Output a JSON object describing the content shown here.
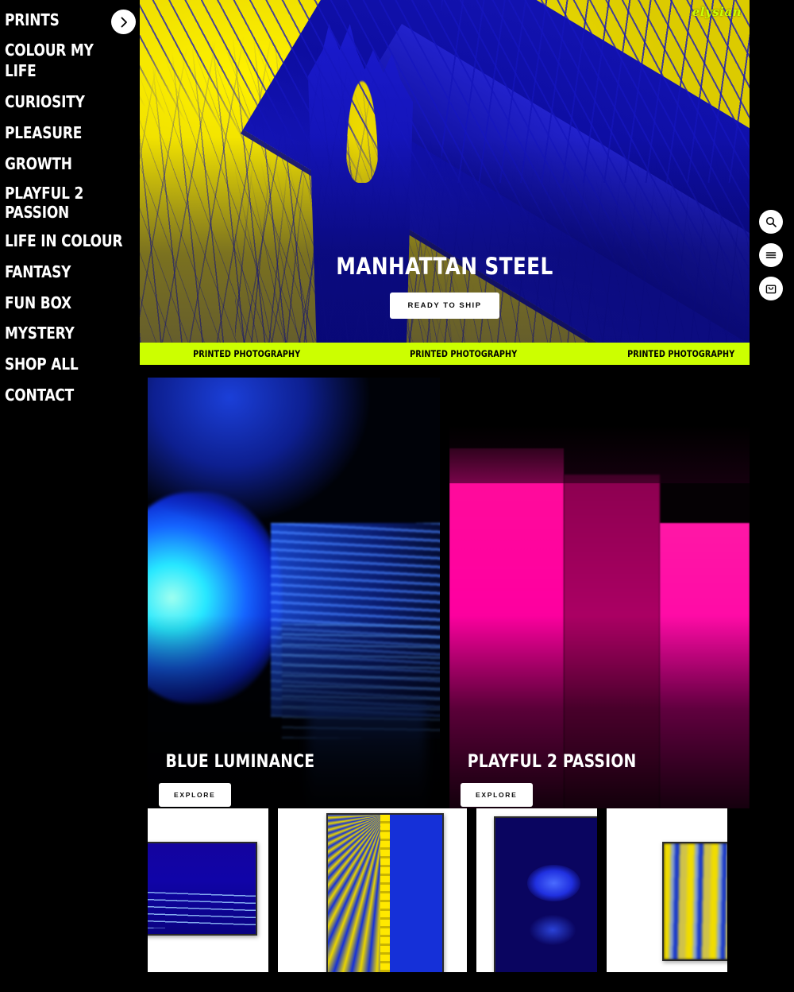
{
  "brand": {
    "logo_text": "elysian"
  },
  "sidebar": {
    "items": [
      {
        "label": "PRINTS",
        "name": "prints"
      },
      {
        "label": "COLOUR MY LIFE",
        "name": "colour-my-life"
      },
      {
        "label": "CURIOSITY",
        "name": "curiosity"
      },
      {
        "label": "PLEASURE",
        "name": "pleasure"
      },
      {
        "label": "GROWTH",
        "name": "growth"
      },
      {
        "label": "PLAYFUL 2\nPASSION",
        "name": "playful-2-passion"
      },
      {
        "label": "LIFE IN COLOUR",
        "name": "life-in-colour"
      },
      {
        "label": "FANTASY",
        "name": "fantasy"
      },
      {
        "label": "FUN BOX",
        "name": "fun-box"
      },
      {
        "label": "MYSTERY",
        "name": "mystery"
      },
      {
        "label": "SHOP ALL",
        "name": "shop-all"
      },
      {
        "label": "CONTACT",
        "name": "contact"
      }
    ],
    "expand_icon": "chevron-right-icon"
  },
  "hero": {
    "title": "MANHATTAN STEEL",
    "cta_label": "READY TO SHIP",
    "image_alt": "manhattan-bridge-duotone",
    "colors": {
      "sky": "#ecdc00",
      "structure": "#1414b4"
    }
  },
  "marquee": {
    "items": [
      "PRINTED PHOTOGRAPHY",
      "PRINTED PHOTOGRAPHY",
      "PRINTED PHOTOGRAPHY"
    ],
    "background": "#ccff00",
    "text_color": "#000000"
  },
  "collections": [
    {
      "title": "BLUE LUMINANCE",
      "cta_label": "EXPLORE",
      "name": "blue-luminance",
      "accent": "#1564ff"
    },
    {
      "title": "PLAYFUL 2 PASSION",
      "cta_label": "EXPLORE",
      "name": "playful-2-passion",
      "accent": "#ff00a0"
    }
  ],
  "thumbnails": [
    {
      "name": "framed-print-blue-cityscape"
    },
    {
      "name": "framed-print-yellow-blue-rays"
    },
    {
      "name": "framed-print-blue-orb"
    },
    {
      "name": "framed-print-yellow-blue-blur"
    }
  ],
  "actions": [
    {
      "name": "search",
      "icon": "search-icon"
    },
    {
      "name": "menu",
      "icon": "hamburger-menu-icon"
    },
    {
      "name": "cart",
      "icon": "shopping-bag-icon"
    }
  ]
}
